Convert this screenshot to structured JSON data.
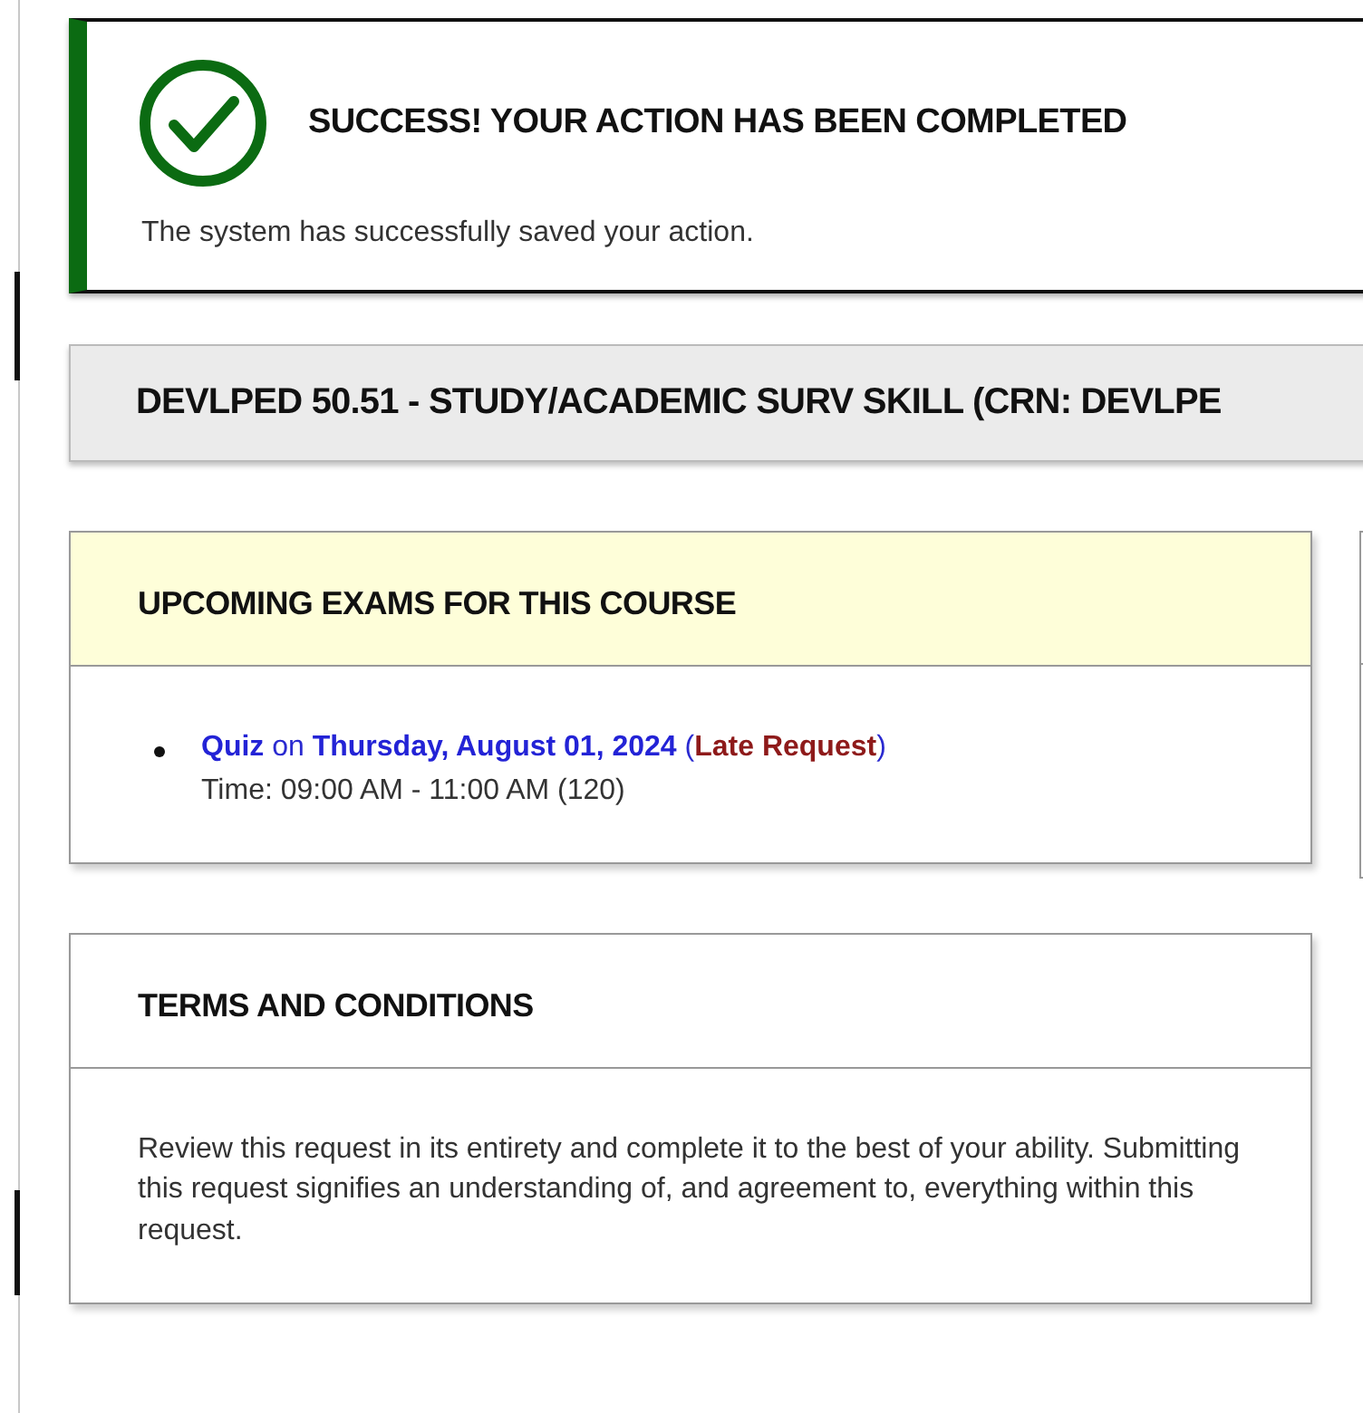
{
  "alert": {
    "kind": "success",
    "title": "SUCCESS! YOUR ACTION HAS BEEN COMPLETED",
    "message": "The system has successfully saved your action."
  },
  "course_title": "DEVLPED 50.51 - STUDY/ACADEMIC SURV SKILL (CRN: DEVLPE",
  "exams_panel": {
    "title": "UPCOMING EXAMS FOR THIS COURSE",
    "exams": [
      {
        "segments": [
          {
            "kind": "link",
            "text": "Quiz"
          },
          {
            "kind": "plain",
            "text": " on "
          },
          {
            "kind": "link",
            "text": "Thursday, August 01, 2024"
          },
          {
            "kind": "plain",
            "text": " ("
          },
          {
            "kind": "status",
            "text": "Late Request"
          },
          {
            "kind": "plain",
            "text": ")"
          }
        ],
        "time": "Time: 09:00 AM - 11:00 AM (120)"
      }
    ]
  },
  "terms_panel": {
    "title": "TERMS AND CONDITIONS",
    "text": "Review this request in its entirety and complete it to the best of your ability. Submitting this request signifies an understanding of, and agreement to, everything within this request."
  }
}
